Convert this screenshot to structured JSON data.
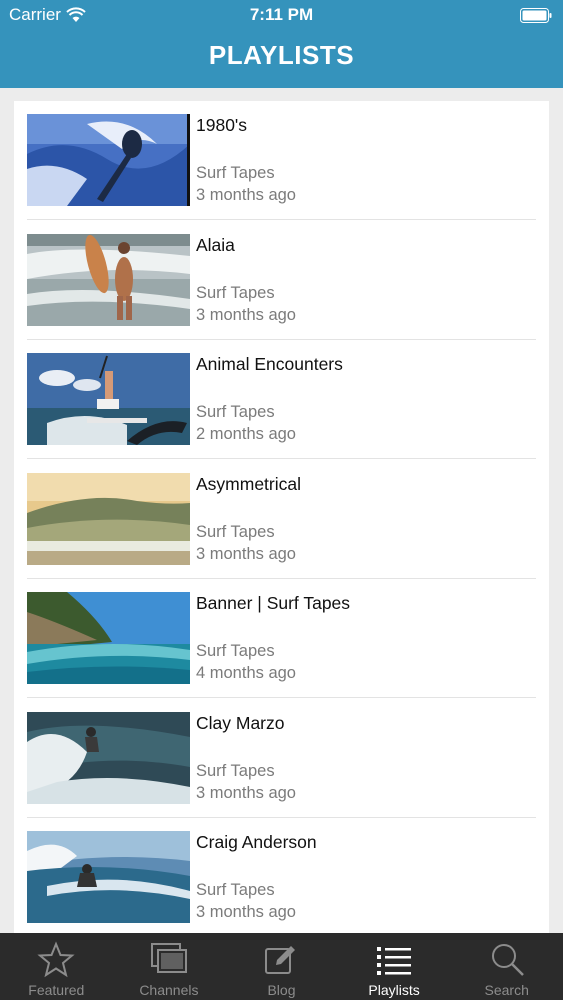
{
  "status_bar": {
    "carrier": "Carrier",
    "time": "7:11 PM"
  },
  "header": {
    "title": "PLAYLISTS"
  },
  "playlists": [
    {
      "title": "1980's",
      "channel": "Surf Tapes",
      "age": "3 months ago",
      "thumbnail": "surfer-cutback-1980s"
    },
    {
      "title": "Alaia",
      "channel": "Surf Tapes",
      "age": "3 months ago",
      "thumbnail": "surfer-holding-alaia-board"
    },
    {
      "title": "Animal Encounters",
      "channel": "Surf Tapes",
      "age": "2 months ago",
      "thumbnail": "surfer-with-whale"
    },
    {
      "title": "Asymmetrical",
      "channel": "Surf Tapes",
      "age": "3 months ago",
      "thumbnail": "golden-wave"
    },
    {
      "title": "Banner | Surf Tapes",
      "channel": "Surf Tapes",
      "age": "4 months ago",
      "thumbnail": "cliff-and-wave"
    },
    {
      "title": "Clay Marzo",
      "channel": "Surf Tapes",
      "age": "3 months ago",
      "thumbnail": "surfer-spray"
    },
    {
      "title": "Craig Anderson",
      "channel": "Surf Tapes",
      "age": "3 months ago",
      "thumbnail": "surfer-on-wave-face"
    }
  ],
  "tab_bar": {
    "tabs": [
      {
        "label": "Featured",
        "icon": "star-icon",
        "active": false
      },
      {
        "label": "Channels",
        "icon": "channels-icon",
        "active": false
      },
      {
        "label": "Blog",
        "icon": "edit-icon",
        "active": false
      },
      {
        "label": "Playlists",
        "icon": "list-icon",
        "active": true
      },
      {
        "label": "Search",
        "icon": "search-icon",
        "active": false
      }
    ]
  },
  "colors": {
    "header": "#3593bc",
    "tab_bar": "#2b2b2b",
    "tab_active": "#ffffff",
    "tab_inactive": "#8c8c8c"
  }
}
